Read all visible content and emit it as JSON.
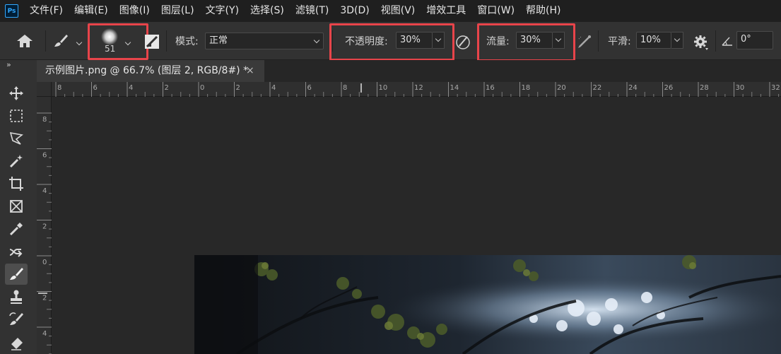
{
  "app": {
    "logo": "Ps"
  },
  "menu": [
    "文件(F)",
    "编辑(E)",
    "图像(I)",
    "图层(L)",
    "文字(Y)",
    "选择(S)",
    "滤镜(T)",
    "3D(D)",
    "视图(V)",
    "增效工具",
    "窗口(W)",
    "帮助(H)"
  ],
  "options": {
    "brush_size": "51",
    "mode_label": "模式:",
    "mode_value": "正常",
    "opacity_label": "不透明度:",
    "opacity_value": "30%",
    "flow_label": "流量:",
    "flow_value": "30%",
    "smooth_label": "平滑:",
    "smooth_value": "10%",
    "angle_value": "0°",
    "highlight_color": "#e8444a"
  },
  "tab": {
    "title": "示例图片.png @ 66.7% (图层 2, RGB/8#) *",
    "close": "×"
  },
  "toolbox": {
    "collapse": "»",
    "tools": [
      "move-icon",
      "marquee-icon",
      "lasso-icon",
      "magic-wand-icon",
      "crop-icon",
      "frame-icon",
      "eyedropper-icon",
      "healing-icon",
      "brush-icon",
      "stamp-icon",
      "history-brush-icon",
      "eraser-icon"
    ],
    "active": "brush-icon"
  },
  "ruler": {
    "top_labels": [
      "8",
      "6",
      "4",
      "2",
      "0",
      "2",
      "4",
      "6",
      "8",
      "10",
      "12",
      "14",
      "16",
      "18",
      "20",
      "22",
      "24",
      "26",
      "28",
      "30",
      "32"
    ],
    "left_labels": [
      "8",
      "6",
      "4",
      "2",
      "0",
      "2",
      "4"
    ]
  }
}
